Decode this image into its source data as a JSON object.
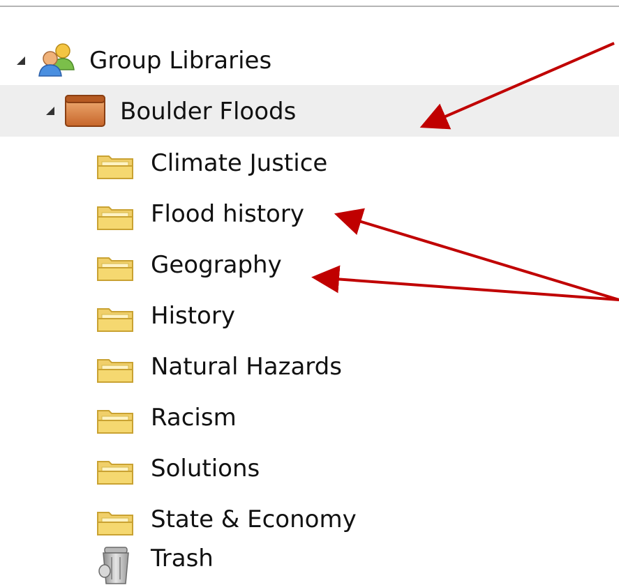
{
  "tree": {
    "group_libraries": {
      "label": "Group Libraries",
      "icon": "group-users-icon"
    },
    "library": {
      "label": "Boulder Floods",
      "icon": "library-box-icon",
      "selected": true
    },
    "collections": [
      {
        "label": "Climate Justice",
        "icon": "folder-icon"
      },
      {
        "label": "Flood history",
        "icon": "folder-icon"
      },
      {
        "label": "Geography",
        "icon": "folder-icon"
      },
      {
        "label": "History",
        "icon": "folder-icon"
      },
      {
        "label": "Natural Hazards",
        "icon": "folder-icon"
      },
      {
        "label": "Racism",
        "icon": "folder-icon"
      },
      {
        "label": "Solutions",
        "icon": "folder-icon"
      },
      {
        "label": "State & Economy",
        "icon": "folder-icon"
      }
    ],
    "trash": {
      "label": "Trash",
      "icon": "trash-icon"
    }
  },
  "annotation": {
    "arrow_color": "#c00000"
  }
}
